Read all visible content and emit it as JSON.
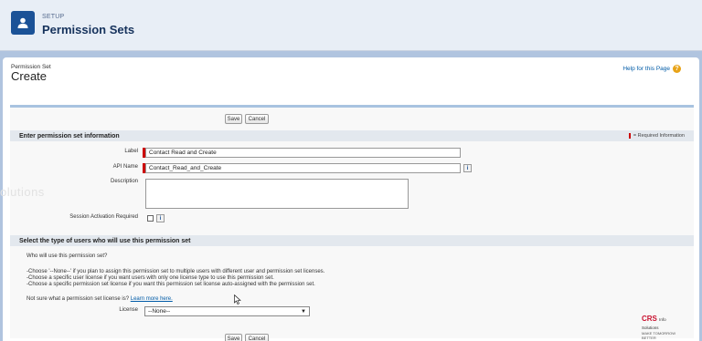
{
  "header": {
    "eyebrow": "SETUP",
    "title": "Permission Sets",
    "icon": "user-icon"
  },
  "page": {
    "label": "Permission Set",
    "title": "Create",
    "help_link": "Help for this Page",
    "help_icon": "help-icon"
  },
  "buttons": {
    "save": "Save",
    "cancel": "Cancel"
  },
  "section1": {
    "title": "Enter permission set information",
    "required_info": "= Required Information"
  },
  "fields": {
    "label": {
      "label": "Label",
      "value": "Contact Read and Create"
    },
    "api_name": {
      "label": "API Name",
      "value": "Contact_Read_and_Create"
    },
    "description": {
      "label": "Description",
      "value": ""
    },
    "session_activation": {
      "label": "Session Activation Required",
      "checked": false
    }
  },
  "section2": {
    "title": "Select the type of users who will use this permission set",
    "question": "Who will use this permission set?",
    "line1": "-Choose '--None--' if you plan to assign this permission set to multiple users with different user and permission set licenses.",
    "line2": "-Choose a specific user license if you want users with only one license type to use this permission set.",
    "line3": "-Choose a specific permission set license if you want this permission set license auto-assigned with the permission set.",
    "not_sure": "Not sure what a permission set license is?",
    "learn_more": "Learn more here.",
    "license_label": "License",
    "license_value": "--None--"
  },
  "watermark": "olutions",
  "logo": {
    "main": "CRS",
    "suffix": "Info Solutions",
    "tagline": "MAKE TOMORROW BETTER"
  }
}
